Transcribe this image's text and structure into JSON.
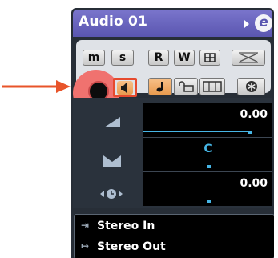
{
  "track": {
    "name": "Audio 01"
  },
  "buttons": {
    "mute": "m",
    "solo": "s",
    "read": "R",
    "write": "W"
  },
  "colors": {
    "titlebar": "#5a56b0",
    "record_ring": "#f0726f",
    "monitor_highlight": "#e64a2e",
    "accent_blue": "#46b6e6",
    "arrow": "#e8542a"
  },
  "faders": {
    "volume": {
      "value": "0.00",
      "level": 0.82
    },
    "pan": {
      "value": "C",
      "level": 0.5
    },
    "delay": {
      "value": "0.00",
      "level": 0.5
    }
  },
  "routing": {
    "input": "Stereo In",
    "output": "Stereo Out"
  },
  "icons": [
    "arrow-right-icon",
    "expand-triangle-icon",
    "edit-e-icon",
    "record-icon",
    "monitor-speaker-icon",
    "note-icon",
    "lock-icon",
    "lane-icon",
    "freeze-icon",
    "fader-icon",
    "pan-icon",
    "delay-icon",
    "input-icon",
    "output-icon"
  ]
}
